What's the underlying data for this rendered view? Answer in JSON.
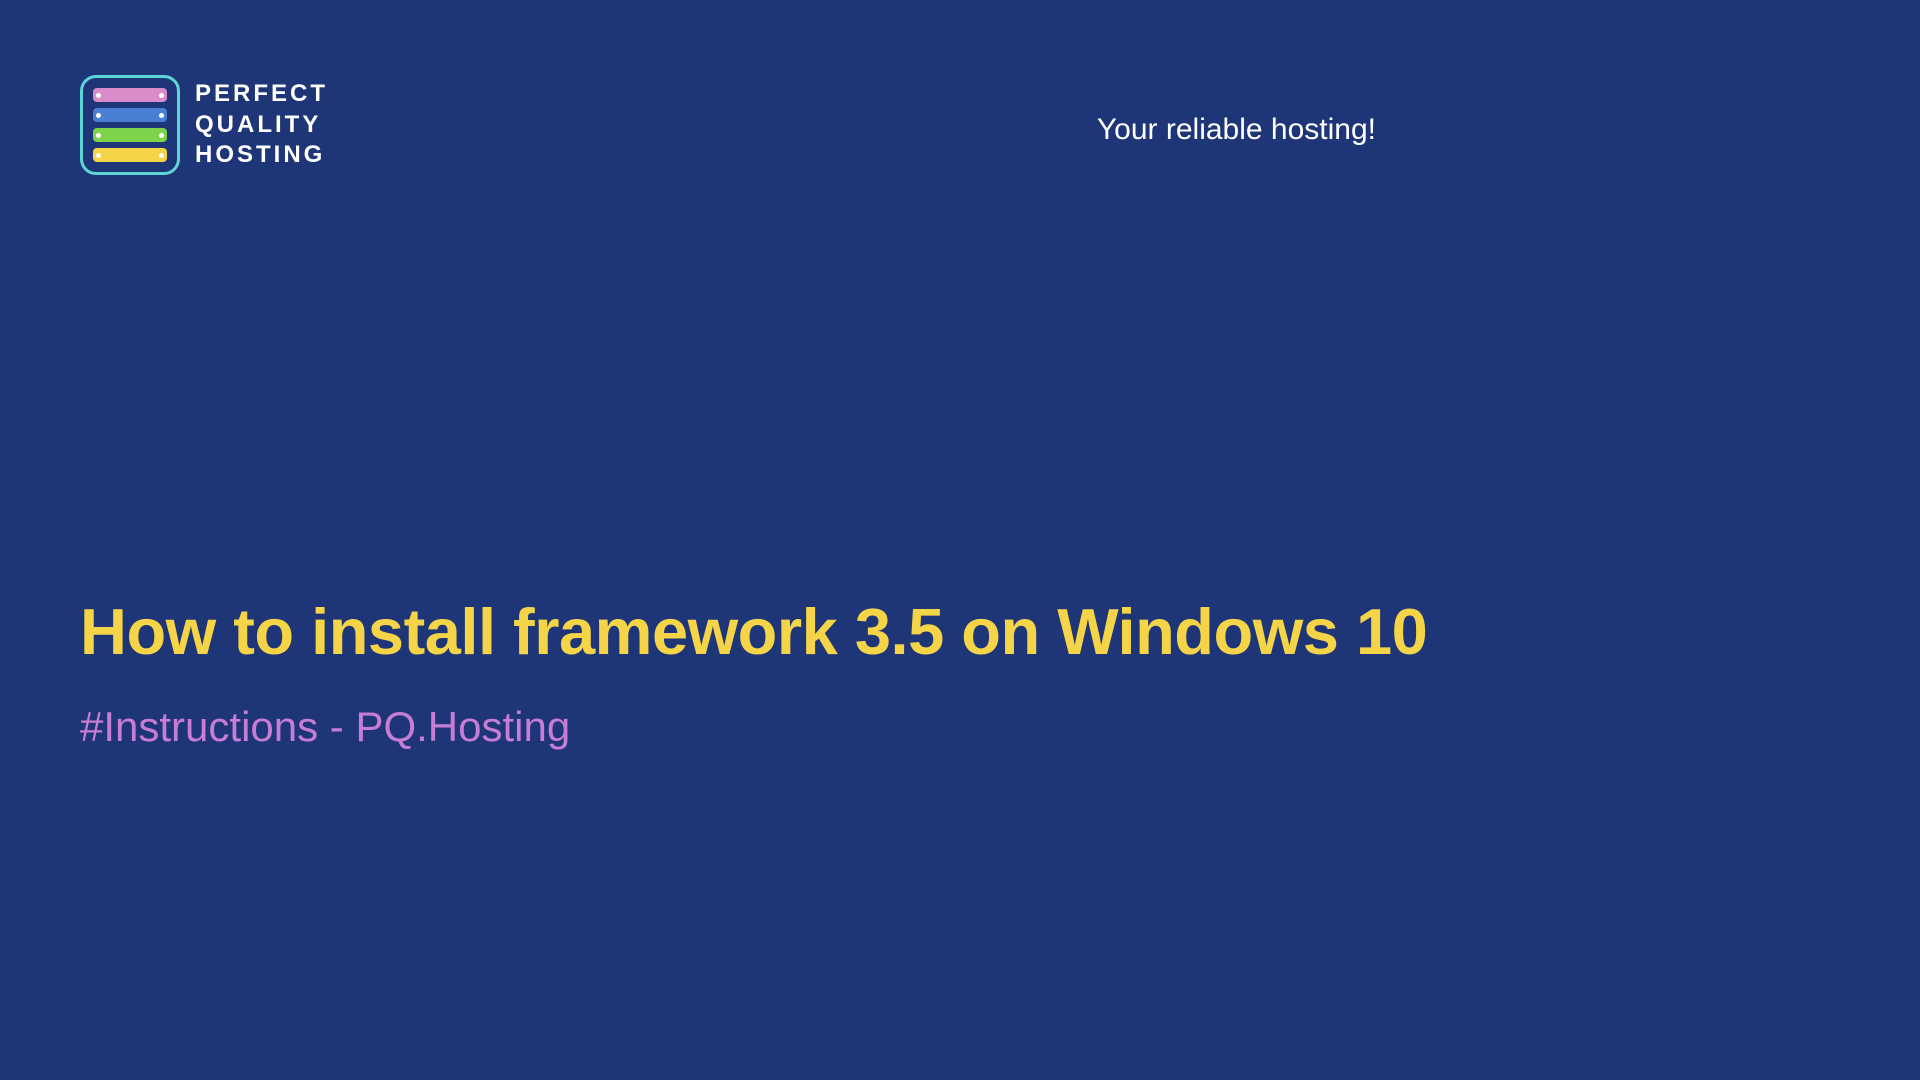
{
  "logo": {
    "line1": "PERFECT",
    "line2": "QUALITY",
    "line3": "HOSTING"
  },
  "tagline": "Your reliable hosting!",
  "title": "How to install framework 3.5 on Windows 10",
  "subtitle": "#Instructions - PQ.Hosting"
}
